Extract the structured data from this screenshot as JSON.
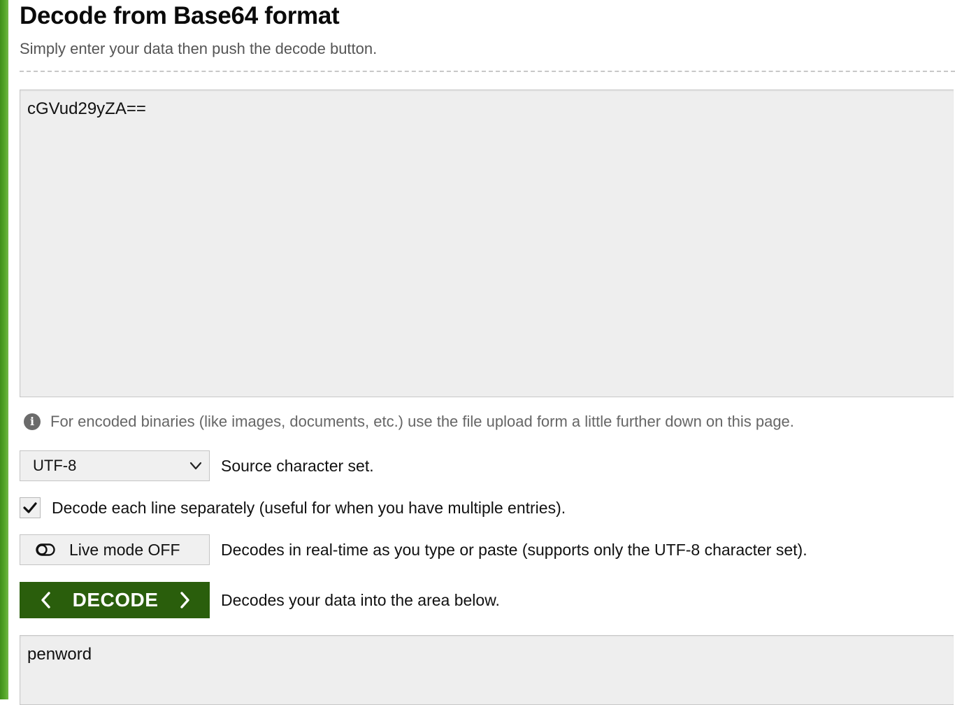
{
  "header": {
    "title": "Decode from Base64 format",
    "subtitle": "Simply enter your data then push the decode button."
  },
  "input": {
    "value": "cGVud29yZA=="
  },
  "info": {
    "icon": "info-icon",
    "text": "For encoded binaries (like images, documents, etc.) use the file upload form a little further down on this page."
  },
  "charset": {
    "selected": "UTF-8",
    "label": "Source character set."
  },
  "lines": {
    "checked": true,
    "label": "Decode each line separately (useful for when you have multiple entries)."
  },
  "live_mode": {
    "button_label": "Live mode OFF",
    "description": "Decodes in real-time as you type or paste (supports only the UTF-8 character set)."
  },
  "decode": {
    "button_label": "DECODE",
    "description": "Decodes your data into the area below."
  },
  "output": {
    "value": "penword"
  },
  "colors": {
    "accent_green": "#2a5e0c",
    "sidebar_green": "#56a82a"
  }
}
